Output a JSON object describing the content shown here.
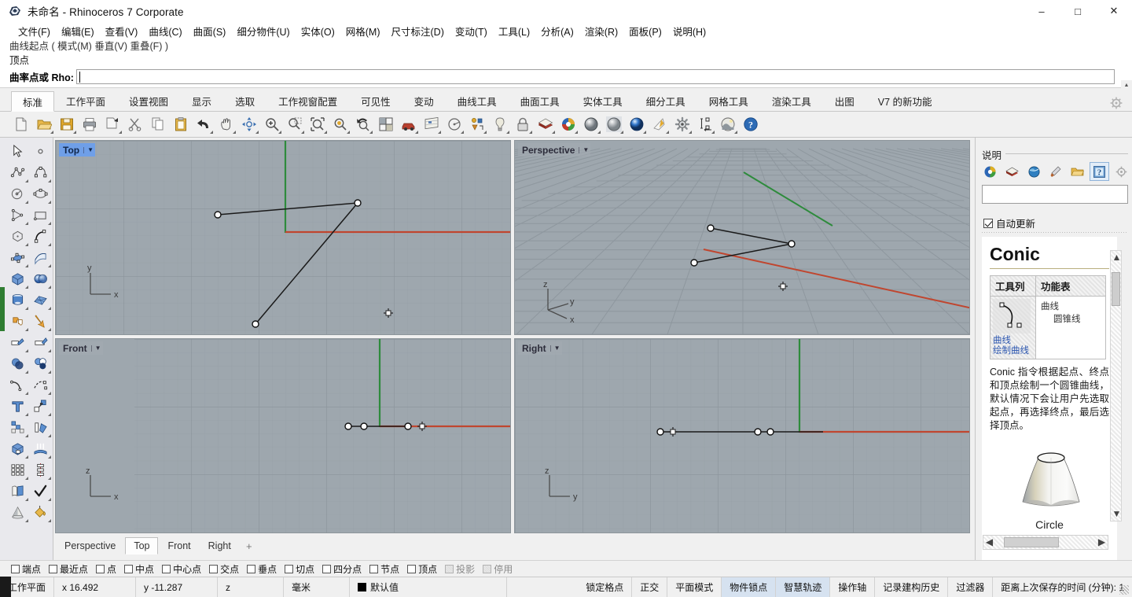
{
  "window": {
    "title": "未命名 - Rhinoceros 7 Corporate",
    "app_icon": "rhino-logo-icon",
    "minimize": "–",
    "maximize": "□",
    "close": "✕"
  },
  "menubar": {
    "items": [
      {
        "label": "文件(F)",
        "name": "menu-file"
      },
      {
        "label": "编辑(E)",
        "name": "menu-edit"
      },
      {
        "label": "查看(V)",
        "name": "menu-view"
      },
      {
        "label": "曲线(C)",
        "name": "menu-curve"
      },
      {
        "label": "曲面(S)",
        "name": "menu-surface"
      },
      {
        "label": "细分物件(U)",
        "name": "menu-subd"
      },
      {
        "label": "实体(O)",
        "name": "menu-solid"
      },
      {
        "label": "网格(M)",
        "name": "menu-mesh"
      },
      {
        "label": "尺寸标注(D)",
        "name": "menu-dimension"
      },
      {
        "label": "变动(T)",
        "name": "menu-transform"
      },
      {
        "label": "工具(L)",
        "name": "menu-tools"
      },
      {
        "label": "分析(A)",
        "name": "menu-analyze"
      },
      {
        "label": "渲染(R)",
        "name": "menu-render"
      },
      {
        "label": "面板(P)",
        "name": "menu-panels"
      },
      {
        "label": "说明(H)",
        "name": "menu-help"
      }
    ]
  },
  "command": {
    "history_faded": "曲线起点 ( 模式(M)  垂直(V)  重叠(F) )",
    "history_line": "顶点",
    "prompt_label": "曲率点或 Rho:",
    "input_value": "",
    "input_placeholder": ""
  },
  "ribbon": {
    "tabs": [
      {
        "label": "标准",
        "name": "ribbon-tab-standard",
        "active": true
      },
      {
        "label": "工作平面",
        "name": "ribbon-tab-cplane",
        "active": false
      },
      {
        "label": "设置视图",
        "name": "ribbon-tab-setview",
        "active": false
      },
      {
        "label": "显示",
        "name": "ribbon-tab-display",
        "active": false
      },
      {
        "label": "选取",
        "name": "ribbon-tab-select",
        "active": false
      },
      {
        "label": "工作视窗配置",
        "name": "ribbon-tab-viewport-layout",
        "active": false
      },
      {
        "label": "可见性",
        "name": "ribbon-tab-visibility",
        "active": false
      },
      {
        "label": "变动",
        "name": "ribbon-tab-transform",
        "active": false
      },
      {
        "label": "曲线工具",
        "name": "ribbon-tab-curve-tools",
        "active": false
      },
      {
        "label": "曲面工具",
        "name": "ribbon-tab-surface-tools",
        "active": false
      },
      {
        "label": "实体工具",
        "name": "ribbon-tab-solid-tools",
        "active": false
      },
      {
        "label": "细分工具",
        "name": "ribbon-tab-subd-tools",
        "active": false
      },
      {
        "label": "网格工具",
        "name": "ribbon-tab-mesh-tools",
        "active": false
      },
      {
        "label": "渲染工具",
        "name": "ribbon-tab-render-tools",
        "active": false
      },
      {
        "label": "出图",
        "name": "ribbon-tab-drafting",
        "active": false
      },
      {
        "label": "V7 的新功能",
        "name": "ribbon-tab-whats-new-v7",
        "active": false
      }
    ],
    "gear": "gear-icon"
  },
  "main_toolbar": {
    "tools": [
      {
        "name": "new-file-icon",
        "flyout": false
      },
      {
        "name": "open-file-icon",
        "flyout": true
      },
      {
        "name": "save-file-icon",
        "flyout": true
      },
      {
        "name": "print-icon",
        "flyout": false
      },
      {
        "name": "cut-copy-paste-group-icon",
        "flyout": true
      },
      {
        "name": "cut-scissors-icon",
        "flyout": false
      },
      {
        "name": "copy-icon",
        "flyout": false
      },
      {
        "name": "paste-icon",
        "flyout": false
      },
      {
        "name": "undo-icon",
        "flyout": true
      },
      {
        "name": "pan-hand-icon",
        "flyout": true
      },
      {
        "name": "rotate-view-icon",
        "flyout": true
      },
      {
        "name": "zoom-in-icon",
        "flyout": true
      },
      {
        "name": "zoom-window-icon",
        "flyout": true
      },
      {
        "name": "zoom-extents-icon",
        "flyout": true
      },
      {
        "name": "zoom-selected-icon",
        "flyout": true
      },
      {
        "name": "zoom-previous-icon",
        "flyout": true
      },
      {
        "name": "four-viewport-icon",
        "flyout": false
      },
      {
        "name": "named-view-car-icon",
        "flyout": true
      },
      {
        "name": "layout-page-icon",
        "flyout": true
      },
      {
        "name": "circle-dimension-icon",
        "flyout": true
      },
      {
        "name": "object-properties-icon",
        "flyout": true
      },
      {
        "name": "light-bulb-icon",
        "flyout": true
      },
      {
        "name": "lock-icon",
        "flyout": true
      },
      {
        "name": "layers-book-icon",
        "flyout": true
      },
      {
        "name": "color-wheel-icon",
        "flyout": true
      },
      {
        "name": "shaded-sphere-icon",
        "flyout": true
      },
      {
        "name": "ghosted-sphere-icon",
        "flyout": true
      },
      {
        "name": "rendered-sphere-icon",
        "flyout": true
      },
      {
        "name": "arctic-display-icon",
        "flyout": true
      },
      {
        "name": "options-gear-icon",
        "flyout": true
      },
      {
        "name": "distance-measure-icon",
        "flyout": true
      },
      {
        "name": "render-preview-icon",
        "flyout": true
      },
      {
        "name": "help-question-icon",
        "flyout": false
      }
    ]
  },
  "left_toolbar": {
    "tools": [
      {
        "name": "select-arrow-icon"
      },
      {
        "name": "point-object-icon"
      },
      {
        "name": "polyline-icon"
      },
      {
        "name": "control-point-curve-icon"
      },
      {
        "name": "circle-icon"
      },
      {
        "name": "ellipse-icon"
      },
      {
        "name": "polygon-triangle-icon"
      },
      {
        "name": "rectangle-icon"
      },
      {
        "name": "polygon-hexagon-icon"
      },
      {
        "name": "arc-curve-icon"
      },
      {
        "name": "surface-from-points-icon"
      },
      {
        "name": "extrude-surface-icon"
      },
      {
        "name": "box-solid-icon"
      },
      {
        "name": "boolean-spheres-icon"
      },
      {
        "name": "revolve-solid-icon"
      },
      {
        "name": "mesh-object-icon"
      },
      {
        "name": "explode-puzzle-icon"
      },
      {
        "name": "join-arrow-icon"
      },
      {
        "name": "trim-icon"
      },
      {
        "name": "split-icon"
      },
      {
        "name": "boolean-union-icon"
      },
      {
        "name": "boolean-difference-icon"
      },
      {
        "name": "fillet-curve-icon"
      },
      {
        "name": "blend-curve-icon"
      },
      {
        "name": "text-tool-icon"
      },
      {
        "name": "move-object-icon"
      },
      {
        "name": "copy-objects-icon"
      },
      {
        "name": "rotate-object-icon"
      },
      {
        "name": "cage-edit-icon"
      },
      {
        "name": "flow-along-surface-icon"
      },
      {
        "name": "array-grid-icon"
      },
      {
        "name": "array-along-curve-icon"
      },
      {
        "name": "unroll-surface-icon"
      },
      {
        "name": "check-object-icon"
      },
      {
        "name": "cone-solid-icon"
      },
      {
        "name": "paint-bucket-icon"
      }
    ]
  },
  "viewports": [
    {
      "name": "viewport-top",
      "label": "Top",
      "active": true,
      "axes": {
        "x": "x",
        "y": "y"
      }
    },
    {
      "name": "viewport-perspective",
      "label": "Perspective",
      "active": false,
      "axes": {
        "x": "x",
        "y": "y",
        "z": "z"
      }
    },
    {
      "name": "viewport-front",
      "label": "Front",
      "active": false,
      "axes": {
        "x": "x",
        "z": "z"
      }
    },
    {
      "name": "viewport-right",
      "label": "Right",
      "active": false,
      "axes": {
        "y": "y",
        "z": "z"
      }
    }
  ],
  "viewport_tabs": {
    "items": [
      {
        "label": "Perspective",
        "name": "viewport-tab-perspective",
        "active": false
      },
      {
        "label": "Top",
        "name": "viewport-tab-top",
        "active": true
      },
      {
        "label": "Front",
        "name": "viewport-tab-front",
        "active": false
      },
      {
        "label": "Right",
        "name": "viewport-tab-right",
        "active": false
      }
    ],
    "add": "+"
  },
  "help_panel": {
    "title": "说明",
    "tabs": [
      {
        "name": "rendering-panel-icon",
        "active": false
      },
      {
        "name": "layers-panel-icon",
        "active": false
      },
      {
        "name": "environment-panel-icon",
        "active": false
      },
      {
        "name": "materials-panel-icon",
        "active": false
      },
      {
        "name": "libraries-folder-icon",
        "active": false
      },
      {
        "name": "help-panel-icon",
        "active": true
      },
      {
        "name": "panel-options-gear-icon",
        "active": false
      }
    ],
    "search_value": "",
    "search_placeholder": "",
    "auto_update_label": "自动更新",
    "auto_update_checked": true,
    "doc": {
      "heading": "Conic",
      "table_headers": [
        "工具列",
        "功能表"
      ],
      "menu_path_1": "曲线",
      "menu_path_2": "圆锥线",
      "toolbar_link_1": "曲线",
      "toolbar_link_2": "绘制曲线",
      "body": "Conic 指令根据起点、终点和顶点绘制一个圆锥曲线，默认情况下会让用户先选取起点，再选择终点，最后选择顶点。",
      "figure_caption": "Circle",
      "figure_name": "conic-circle-illustration"
    },
    "scroll_left": "‹",
    "scroll_right": "›",
    "scroll_up": "∧",
    "scroll_down": "∨"
  },
  "osnap": {
    "items": [
      {
        "label": "端点",
        "name": "osnap-end",
        "checked": false,
        "disabled": false
      },
      {
        "label": "最近点",
        "name": "osnap-near",
        "checked": false,
        "disabled": false
      },
      {
        "label": "点",
        "name": "osnap-point",
        "checked": false,
        "disabled": false
      },
      {
        "label": "中点",
        "name": "osnap-mid",
        "checked": false,
        "disabled": false
      },
      {
        "label": "中心点",
        "name": "osnap-center",
        "checked": false,
        "disabled": false
      },
      {
        "label": "交点",
        "name": "osnap-intersect",
        "checked": false,
        "disabled": false
      },
      {
        "label": "垂点",
        "name": "osnap-perp",
        "checked": false,
        "disabled": false
      },
      {
        "label": "切点",
        "name": "osnap-tangent",
        "checked": false,
        "disabled": false
      },
      {
        "label": "四分点",
        "name": "osnap-quad",
        "checked": false,
        "disabled": false
      },
      {
        "label": "节点",
        "name": "osnap-knot",
        "checked": false,
        "disabled": false
      },
      {
        "label": "顶点",
        "name": "osnap-vertex",
        "checked": false,
        "disabled": false
      },
      {
        "label": "投影",
        "name": "osnap-project",
        "checked": false,
        "disabled": true
      },
      {
        "label": "停用",
        "name": "osnap-disable",
        "checked": false,
        "disabled": true
      }
    ]
  },
  "statusbar": {
    "cplane_label": "工作平面",
    "x_label": "x 16.492",
    "y_label": "y -11.287",
    "z_label": "z",
    "units": "毫米",
    "layer_color": "#000000",
    "layer_name": "默认值",
    "toggles": [
      {
        "label": "锁定格点",
        "name": "status-grid-snap",
        "on": false
      },
      {
        "label": "正交",
        "name": "status-ortho",
        "on": false
      },
      {
        "label": "平面模式",
        "name": "status-planar",
        "on": false
      },
      {
        "label": "物件锁点",
        "name": "status-osnap",
        "on": true
      },
      {
        "label": "智慧轨迹",
        "name": "status-smarttrack",
        "on": true
      },
      {
        "label": "操作轴",
        "name": "status-gumball",
        "on": false
      },
      {
        "label": "记录建构历史",
        "name": "status-history",
        "on": false
      },
      {
        "label": "过滤器",
        "name": "status-filter",
        "on": false
      }
    ],
    "autosave": "距离上次保存的时间 (分钟): 1"
  }
}
